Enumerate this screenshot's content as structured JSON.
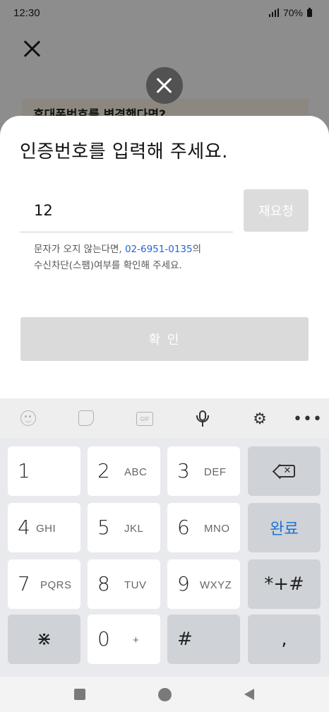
{
  "status_bar": {
    "time": "12:30",
    "battery": "70%"
  },
  "background": {
    "card_text": "휴대폰번호를 변경했다면?"
  },
  "sheet": {
    "title": "인증번호를 입력해 주세요.",
    "code_value": "12",
    "resend_label": "재요청",
    "help_prefix": "문자가 오지 않는다면, ",
    "help_phone": "02-6951-0135",
    "help_suffix_1": "의",
    "help_line2": "수신차단(스팸)여부를 확인해 주세요.",
    "confirm_label": "확 인"
  },
  "keyboard": {
    "toolbar": [
      "emoji-icon",
      "sticker-icon",
      "gif-icon",
      "mic-icon",
      "gear-icon",
      "more-icon"
    ],
    "gif_label": "GIF",
    "keys": {
      "k1": {
        "num": "1",
        "sub": ""
      },
      "k2": {
        "num": "2",
        "sub": "ABC"
      },
      "k3": {
        "num": "3",
        "sub": "DEF"
      },
      "k4": {
        "num": "4",
        "sub": "GHI"
      },
      "k5": {
        "num": "5",
        "sub": "JKL"
      },
      "k6": {
        "num": "6",
        "sub": "MNO"
      },
      "k7": {
        "num": "7",
        "sub": "PQRS"
      },
      "k8": {
        "num": "8",
        "sub": "TUV"
      },
      "k9": {
        "num": "9",
        "sub": "WXYZ"
      },
      "k0": {
        "num": "0",
        "sub": "+"
      },
      "star": "⋇",
      "hash": "#",
      "done": "완료",
      "symbols": "*+#",
      "comma": ","
    },
    "colors": {
      "accent": "#1a74d8"
    }
  }
}
